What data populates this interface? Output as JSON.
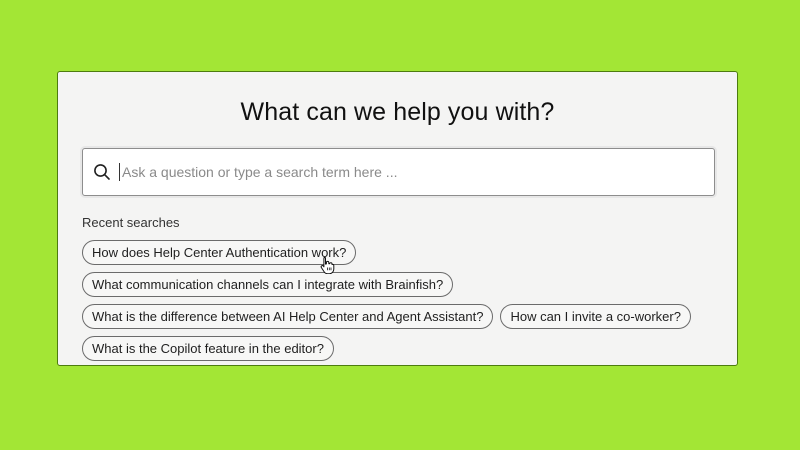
{
  "header": {
    "title": "What can we help you with?"
  },
  "search": {
    "placeholder": "Ask a question or type a search term here ...",
    "value": "",
    "icon": "search-icon"
  },
  "recent": {
    "label": "Recent searches",
    "items": [
      "How does Help Center Authentication work?",
      "What communication channels can I integrate with Brainfish?",
      "What is the difference between AI Help Center and Agent Assistant?",
      "How can I invite a co-worker?",
      "What is the Copilot feature in the editor?"
    ]
  },
  "colors": {
    "background": "#a3e635",
    "card": "#f4f4f3",
    "card_border": "#4d7c0f",
    "chip_border": "#6b6b6b"
  }
}
